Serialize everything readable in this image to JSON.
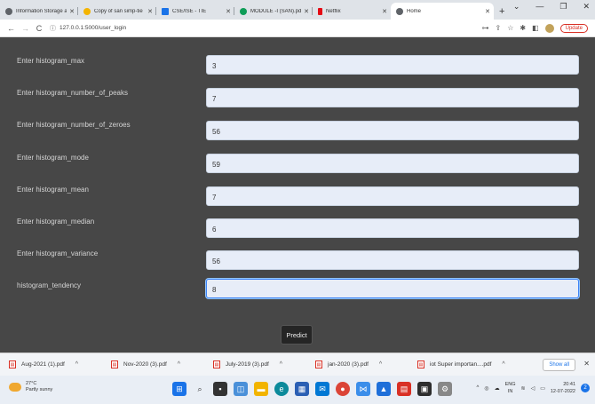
{
  "browser": {
    "tabs": [
      {
        "title": "Information Storage a",
        "color": "#5f6368"
      },
      {
        "title": "Copy of san simp-tie",
        "color": "#f4b400"
      },
      {
        "title": "CSE/ISE - TIE",
        "color": "#1a73e8"
      },
      {
        "title": "MODULE -I (SAN).pdf",
        "color": "#0f9d58"
      },
      {
        "title": "Netflix",
        "color": "#e50914"
      },
      {
        "title": "Home",
        "color": "#5f6368"
      }
    ],
    "url": "127.0.0.1:5000/user_login",
    "update_label": "Update"
  },
  "form": {
    "fields": [
      {
        "label": "Enter histogram_max",
        "value": "3"
      },
      {
        "label": "Enter histogram_number_of_peaks",
        "value": "7"
      },
      {
        "label": "Enter histogram_number_of_zeroes",
        "value": "56"
      },
      {
        "label": "Enter histogram_mode",
        "value": "59"
      },
      {
        "label": "Enter histogram_mean",
        "value": "7"
      },
      {
        "label": "Enter histogram_median",
        "value": "6"
      },
      {
        "label": "Enter histogram_variance",
        "value": "56"
      },
      {
        "label": "histogram_tendency",
        "value": "8"
      }
    ],
    "submit_label": "Predict"
  },
  "downloads": {
    "items": [
      "Aug-2021 (1).pdf",
      "Nov-2020 (3).pdf",
      "July-2019 (3).pdf",
      "jan-2020 (3).pdf",
      "iot Super importan....pdf"
    ],
    "show_all": "Show all"
  },
  "taskbar": {
    "temperature": "27°C",
    "weather": "Partly sunny",
    "lang_1": "ENG",
    "lang_2": "IN",
    "time": "20:41",
    "date": "12-07-2022",
    "notification_count": "2"
  }
}
